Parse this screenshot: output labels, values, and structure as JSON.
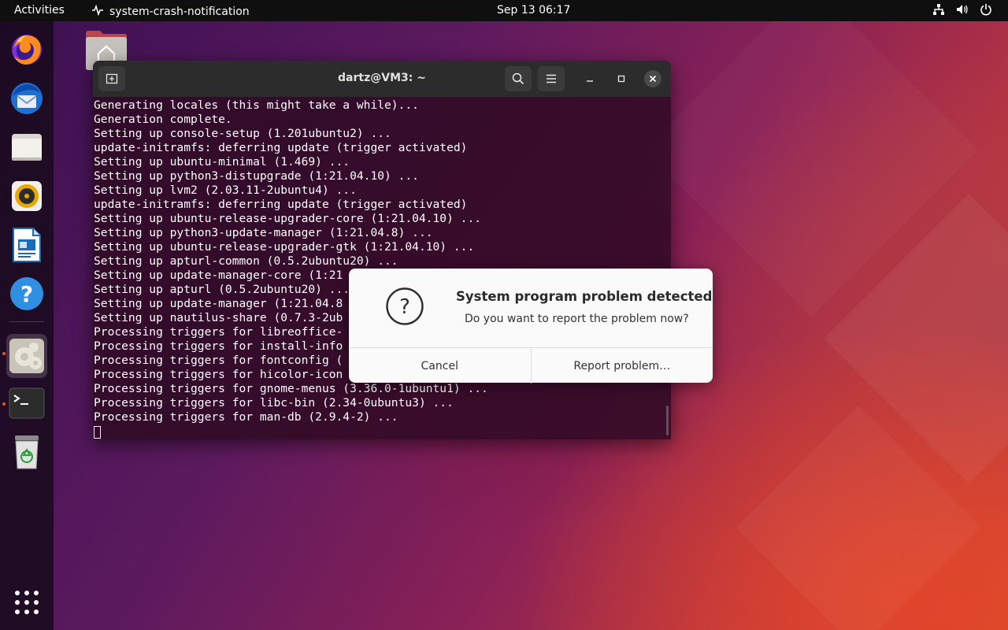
{
  "topbar": {
    "activities": "Activities",
    "app_name": "system-crash-notification",
    "app_icon": "process-icon",
    "clock": "Sep 13  06:17",
    "tray_icons": [
      "network-icon",
      "volume-icon",
      "power-icon"
    ]
  },
  "dock": {
    "items": [
      {
        "name": "firefox",
        "icon": "firefox-icon",
        "running": false
      },
      {
        "name": "thunderbird",
        "icon": "thunderbird-icon",
        "running": false
      },
      {
        "name": "files",
        "icon": "files-icon",
        "running": false
      },
      {
        "name": "rhythmbox",
        "icon": "rhythmbox-icon",
        "running": false
      },
      {
        "name": "libreoffice-writer",
        "icon": "writer-icon",
        "running": false
      },
      {
        "name": "help",
        "icon": "help-icon",
        "running": false
      },
      {
        "name": "software-updater",
        "icon": "updater-icon",
        "running": true,
        "active": true
      },
      {
        "name": "terminal",
        "icon": "terminal-icon",
        "running": true
      },
      {
        "name": "trash",
        "icon": "trash-icon",
        "running": false
      }
    ],
    "show_apps_icon": "app-grid-icon"
  },
  "desktop": {
    "home_icon": "home-folder-icon"
  },
  "terminal": {
    "title": "dartz@VM3: ~",
    "lines": [
      "Generating locales (this might take a while)...",
      "Generation complete.",
      "Setting up console-setup (1.201ubuntu2) ...",
      "update-initramfs: deferring update (trigger activated)",
      "Setting up ubuntu-minimal (1.469) ...",
      "Setting up python3-distupgrade (1:21.04.10) ...",
      "Setting up lvm2 (2.03.11-2ubuntu4) ...",
      "update-initramfs: deferring update (trigger activated)",
      "Setting up ubuntu-release-upgrader-core (1:21.04.10) ...",
      "Setting up python3-update-manager (1:21.04.8) ...",
      "Setting up ubuntu-release-upgrader-gtk (1:21.04.10) ...",
      "Setting up apturl-common (0.5.2ubuntu20) ...",
      "Setting up update-manager-core (1:21",
      "Setting up apturl (0.5.2ubuntu20) ...",
      "Setting up update-manager (1:21.04.8",
      "Setting up nautilus-share (0.7.3-2ub",
      "Processing triggers for libreoffice-",
      "Processing triggers for install-info",
      "Processing triggers for fontconfig (",
      "Processing triggers for hicolor-icon",
      "Processing triggers for gnome-menus (3.36.0-1ubuntu1) ...",
      "Processing triggers for libc-bin (2.34-0ubuntu3) ...",
      "Processing triggers for man-db (2.9.4-2) ..."
    ]
  },
  "dialog": {
    "icon": "question-icon",
    "title": "System program problem detected",
    "message": "Do you want to report the problem now?",
    "cancel_label": "Cancel",
    "report_label": "Report problem…"
  },
  "colors": {
    "ubuntu_orange": "#e95420",
    "terminal_bg": "#300a24"
  }
}
